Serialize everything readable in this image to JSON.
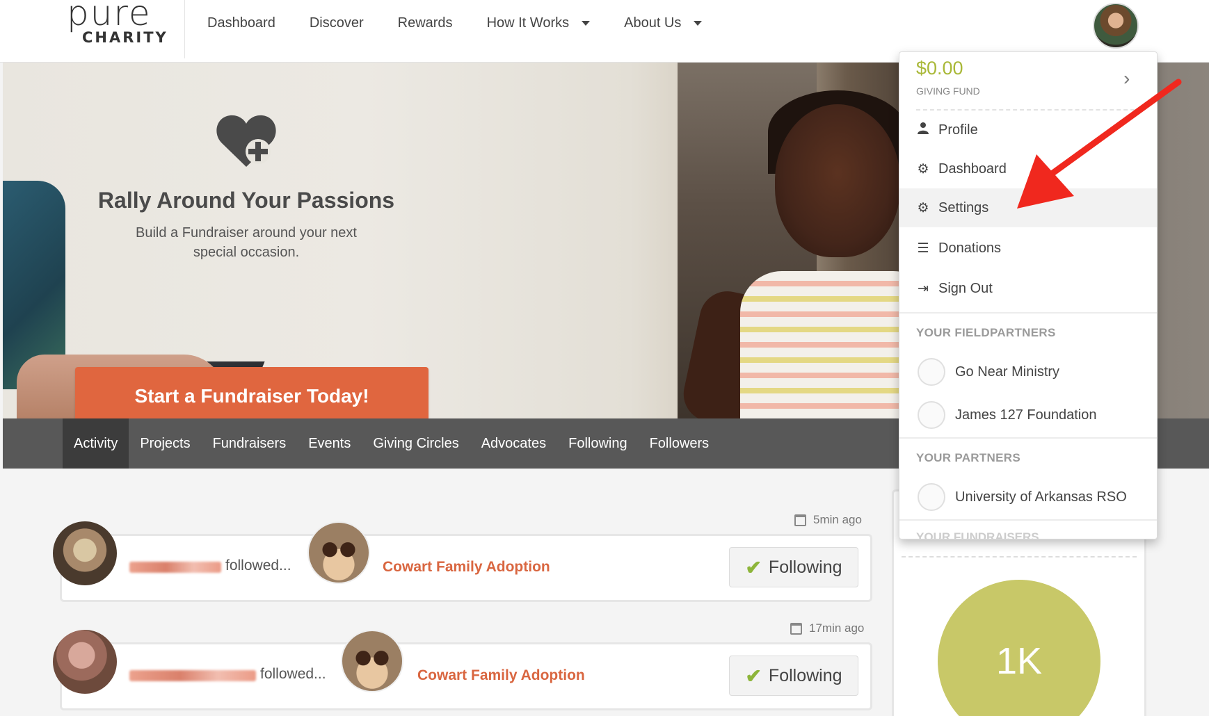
{
  "logo": {
    "line1": "pure",
    "line2": "CHARITY"
  },
  "nav": {
    "items": [
      {
        "label": "Dashboard",
        "dropdown": false
      },
      {
        "label": "Discover",
        "dropdown": false
      },
      {
        "label": "Rewards",
        "dropdown": false
      },
      {
        "label": "How It Works",
        "dropdown": true
      },
      {
        "label": "About Us",
        "dropdown": true
      }
    ]
  },
  "hero": {
    "title": "Rally Around Your Passions",
    "subtitle": "Build a Fundraiser around your next special occasion.",
    "cta_label": "Start a Fundraiser Today!",
    "carousel_active_index": 1,
    "carousel_count": 4
  },
  "tabs": {
    "items": [
      "Activity",
      "Projects",
      "Fundraisers",
      "Events",
      "Giving Circles",
      "Advocates",
      "Following",
      "Followers"
    ],
    "active": "Activity"
  },
  "feed": {
    "items": [
      {
        "time": "5min ago",
        "action": "followed...",
        "project": "Cowart Family Adoption",
        "button_label": "Following"
      },
      {
        "time": "17min ago",
        "action": "followed...",
        "project": "Cowart Family Adoption",
        "button_label": "Following"
      }
    ]
  },
  "side_panel": {
    "badge": "1K"
  },
  "dropdown": {
    "fund_amount": "$0.00",
    "fund_label": "GIVING FUND",
    "menu": [
      {
        "label": "Profile",
        "icon": "user-icon"
      },
      {
        "label": "Dashboard",
        "icon": "gear-icon"
      },
      {
        "label": "Settings",
        "icon": "gear-icon"
      },
      {
        "label": "Donations",
        "icon": "list-icon"
      },
      {
        "label": "Sign Out",
        "icon": "sign-out-icon"
      }
    ],
    "fieldpartners_heading": "YOUR FIELDPARTNERS",
    "fieldpartners": [
      "Go Near Ministry",
      "James 127 Foundation"
    ],
    "partners_heading": "YOUR PARTNERS",
    "partners": [
      "University of Arkansas RSO"
    ],
    "fundraisers_heading": "YOUR FUNDRAISERS"
  },
  "colors": {
    "accent_orange": "#e0663f",
    "link_orange": "#d96640",
    "fund_green": "#a9b838",
    "badge_green": "#c8c868",
    "tabbar": "#585858",
    "annotation_red": "#f0281e"
  }
}
